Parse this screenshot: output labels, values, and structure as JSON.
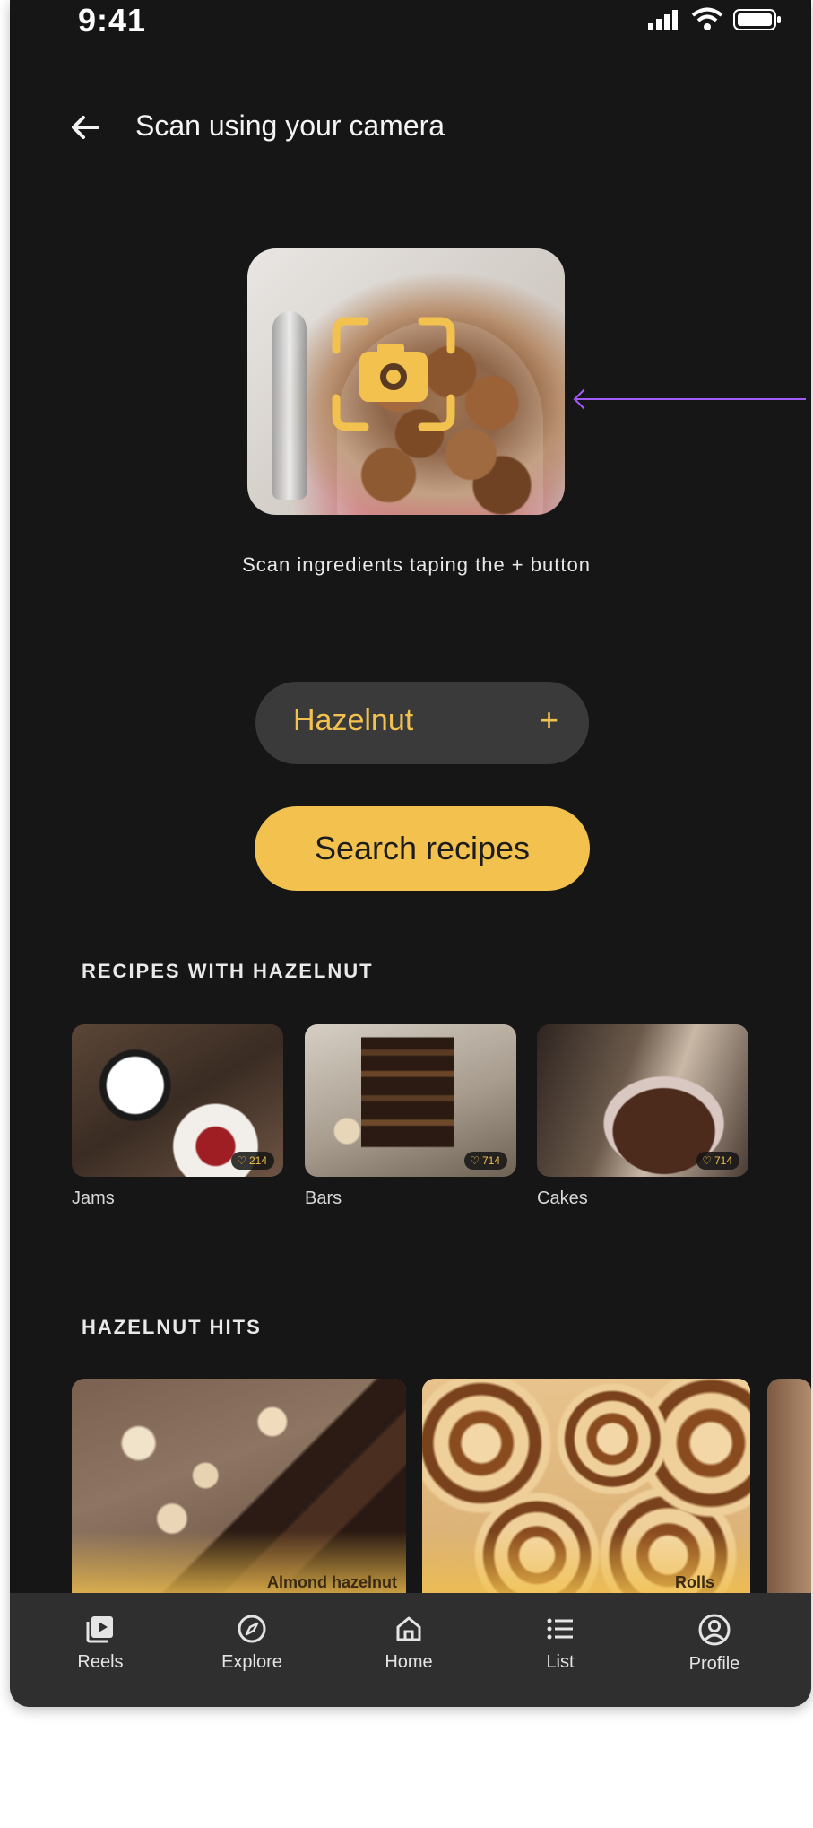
{
  "status_bar": {
    "time": "9:41"
  },
  "header": {
    "title": "Scan using your camera"
  },
  "scan": {
    "hint": "Scan ingredients taping the + button"
  },
  "ingredient_chip": {
    "label": "Hazelnut",
    "plus": "+"
  },
  "search_button": {
    "label": "Search recipes"
  },
  "recipes_section": {
    "title": "RECIPES WITH HAZELNUT",
    "items": [
      {
        "label": "Jams",
        "likes": "214"
      },
      {
        "label": "Bars",
        "likes": "714"
      },
      {
        "label": "Cakes",
        "likes": "714"
      }
    ]
  },
  "hits_section": {
    "title": "HAZELNUT HITS",
    "items": [
      {
        "label": "Almond hazelnut"
      },
      {
        "label": "Rolls"
      }
    ]
  },
  "bottom_nav": {
    "items": [
      {
        "label": "Reels",
        "icon": "reels-icon"
      },
      {
        "label": "Explore",
        "icon": "compass-icon"
      },
      {
        "label": "Home",
        "icon": "home-icon"
      },
      {
        "label": "List",
        "icon": "list-icon"
      },
      {
        "label": "Profile",
        "icon": "profile-icon"
      }
    ]
  },
  "colors": {
    "background": "#161616",
    "accent": "#f2c14e",
    "chip": "#3a3a3a",
    "nav": "#2f2f2f",
    "annotation": "#a35cff"
  }
}
